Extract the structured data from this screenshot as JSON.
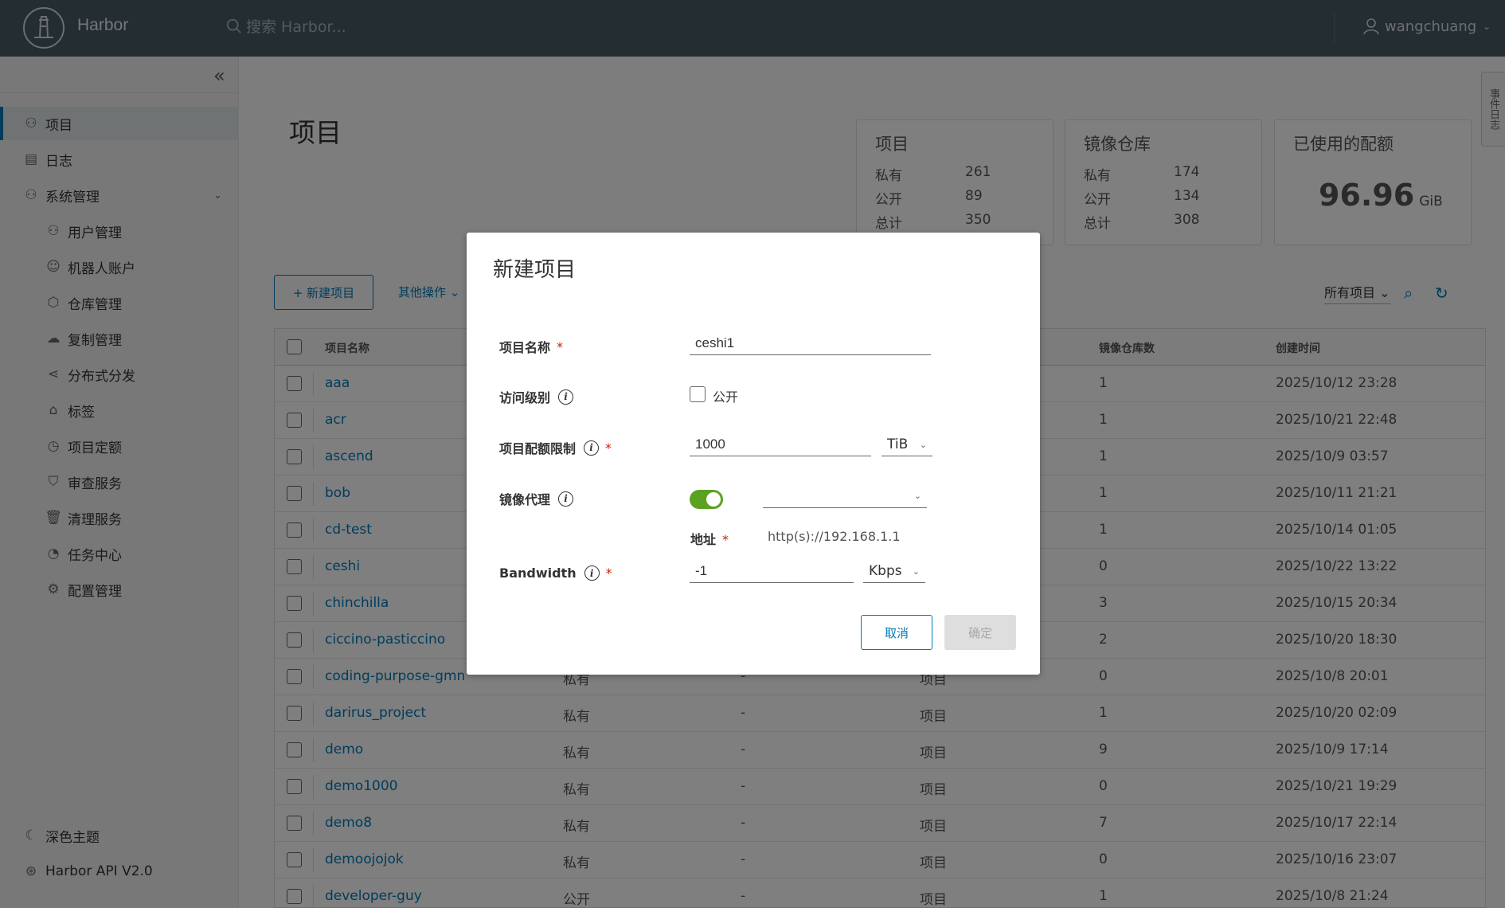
{
  "header": {
    "app_title": "Harbor",
    "search_placeholder": "搜索 Harbor...",
    "username": "wangchuang"
  },
  "sidebar": {
    "items": [
      {
        "label": "项目",
        "icon": "projects-icon"
      },
      {
        "label": "日志",
        "icon": "logs-icon"
      },
      {
        "label": "系统管理",
        "icon": "admin-icon"
      },
      {
        "label": "用户管理",
        "icon": "users-icon"
      },
      {
        "label": "机器人账户",
        "icon": "robot-icon"
      },
      {
        "label": "仓库管理",
        "icon": "registry-icon"
      },
      {
        "label": "复制管理",
        "icon": "replication-icon"
      },
      {
        "label": "分布式分发",
        "icon": "distribution-icon"
      },
      {
        "label": "标签",
        "icon": "tag-icon"
      },
      {
        "label": "项目定额",
        "icon": "quota-icon"
      },
      {
        "label": "审查服务",
        "icon": "shield-icon"
      },
      {
        "label": "清理服务",
        "icon": "trash-icon"
      },
      {
        "label": "任务中心",
        "icon": "clock-icon"
      },
      {
        "label": "配置管理",
        "icon": "gear-icon"
      }
    ],
    "dark_theme": "深色主题",
    "api": "Harbor API V2.0"
  },
  "side_tab": "事件日志",
  "main": {
    "title": "项目",
    "stats": {
      "projects": {
        "title": "项目",
        "private_label": "私有",
        "private": "261",
        "public_label": "公开",
        "public": "89",
        "total_label": "总计",
        "total": "350"
      },
      "repos": {
        "title": "镜像仓库",
        "private_label": "私有",
        "private": "174",
        "public_label": "公开",
        "public": "134",
        "total_label": "总计",
        "total": "308"
      },
      "quota": {
        "title": "已使用的配额",
        "value": "96.96",
        "unit": "GiB"
      }
    },
    "new_project_btn": "+ 新建项目",
    "other_ops": "其他操作",
    "filter": "所有项目",
    "columns": {
      "name": "项目名称",
      "repo_count": "镜像仓库数",
      "created": "创建时间"
    },
    "rows": [
      {
        "name": "aaa",
        "access": "",
        "role": "",
        "type": "",
        "repos": "1",
        "created": "2025/10/12 23:28"
      },
      {
        "name": "acr",
        "access": "",
        "role": "",
        "type": "",
        "repos": "1",
        "created": "2025/10/21 22:48"
      },
      {
        "name": "ascend",
        "access": "",
        "role": "",
        "type": "",
        "repos": "1",
        "created": "2025/10/9 03:57"
      },
      {
        "name": "bob",
        "access": "",
        "role": "",
        "type": "",
        "repos": "1",
        "created": "2025/10/11 21:21"
      },
      {
        "name": "cd-test",
        "access": "",
        "role": "",
        "type": "",
        "repos": "1",
        "created": "2025/10/14 01:05"
      },
      {
        "name": "ceshi",
        "access": "",
        "role": "",
        "type": "",
        "repos": "0",
        "created": "2025/10/22 13:22"
      },
      {
        "name": "chinchilla",
        "access": "",
        "role": "",
        "type": "",
        "repos": "3",
        "created": "2025/10/15 20:34"
      },
      {
        "name": "ciccino-pasticcino",
        "access": "",
        "role": "",
        "type": "",
        "repos": "2",
        "created": "2025/10/20 18:30"
      },
      {
        "name": "coding-purpose-gmn",
        "access": "私有",
        "role": "-",
        "type": "项目",
        "repos": "0",
        "created": "2025/10/8 20:01"
      },
      {
        "name": "darirus_project",
        "access": "私有",
        "role": "-",
        "type": "项目",
        "repos": "1",
        "created": "2025/10/20 02:09"
      },
      {
        "name": "demo",
        "access": "私有",
        "role": "-",
        "type": "项目",
        "repos": "9",
        "created": "2025/10/9 17:14"
      },
      {
        "name": "demo1000",
        "access": "私有",
        "role": "-",
        "type": "项目",
        "repos": "0",
        "created": "2025/10/21 19:29"
      },
      {
        "name": "demo8",
        "access": "私有",
        "role": "-",
        "type": "项目",
        "repos": "7",
        "created": "2025/10/17 22:14"
      },
      {
        "name": "demoojojok",
        "access": "私有",
        "role": "-",
        "type": "项目",
        "repos": "0",
        "created": "2025/10/16 23:07"
      },
      {
        "name": "developer-guy",
        "access": "公开",
        "role": "-",
        "type": "项目",
        "repos": "1",
        "created": "2025/10/8 21:24"
      }
    ]
  },
  "modal": {
    "title": "新建项目",
    "name_label": "项目名称",
    "name_value": "ceshi1",
    "access_label": "访问级别",
    "public_label": "公开",
    "quota_label": "项目配额限制",
    "quota_value": "1000",
    "quota_unit": "TiB",
    "proxy_label": "镜像代理",
    "proxy_enabled": true,
    "proxy_endpoint": "",
    "address_label": "地址",
    "address_value": "http(s)://192.168.1.1",
    "bandwidth_label": "Bandwidth",
    "bandwidth_value": "-1",
    "bandwidth_unit": "Kbps",
    "cancel": "取消",
    "ok": "确定"
  },
  "colors": {
    "header": "#485a62",
    "accent": "#0079b8",
    "toggle_on": "#5aa220",
    "required": "#c92100"
  }
}
